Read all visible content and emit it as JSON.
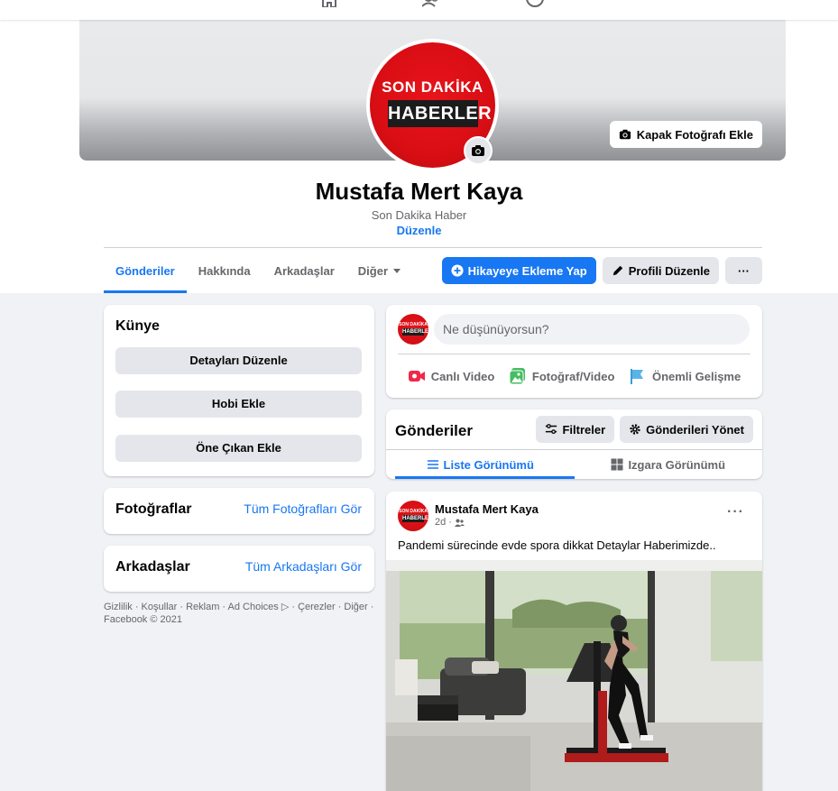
{
  "topnav": {
    "icons": [
      "home-icon",
      "friends-icon",
      "groups-icon"
    ]
  },
  "cover": {
    "add_cover_label": "Kapak Fotoğrafı Ekle"
  },
  "avatar": {
    "line1": "SON DAKİKA",
    "line2": "HABERLER"
  },
  "profile": {
    "name": "Mustafa Mert Kaya",
    "subtitle": "Son Dakika Haber",
    "edit_link": "Düzenle"
  },
  "tabs": [
    {
      "label": "Gönderiler",
      "active": true
    },
    {
      "label": "Hakkında"
    },
    {
      "label": "Arkadaşlar"
    },
    {
      "label": "Diğer"
    }
  ],
  "actions": {
    "add_story": "Hikayeye Ekleme Yap",
    "edit_profile": "Profili Düzenle",
    "more": "···"
  },
  "intro": {
    "title": "Künye",
    "buttons": [
      "Detayları Düzenle",
      "Hobi Ekle",
      "Öne Çıkan Ekle"
    ]
  },
  "photos": {
    "title": "Fotoğraflar",
    "see_all": "Tüm Fotoğrafları Gör"
  },
  "friends": {
    "title": "Arkadaşlar",
    "see_all": "Tüm Arkadaşları Gör"
  },
  "footer": {
    "text": "Gizlilik · Koşullar · Reklam · Ad Choices ▷ · Çerezler · Diğer · Facebook © 2021"
  },
  "composer": {
    "placeholder": "Ne düşünüyorsun?",
    "actions": [
      "Canlı Video",
      "Fotoğraf/Video",
      "Önemli Gelişme"
    ]
  },
  "posts_header": {
    "title": "Gönderiler",
    "filters": "Filtreler",
    "manage": "Gönderileri Yönet",
    "list_view": "Liste Görünümü",
    "grid_view": "Izgara Görünümü"
  },
  "post": {
    "author": "Mustafa Mert Kaya",
    "time": "2d ·",
    "text": "Pandemi sürecinde evde spora dikkat Detaylar Haberimizde..",
    "more": "···"
  },
  "colors": {
    "accent": "#1877f2",
    "brand_red": "#e8141b"
  }
}
